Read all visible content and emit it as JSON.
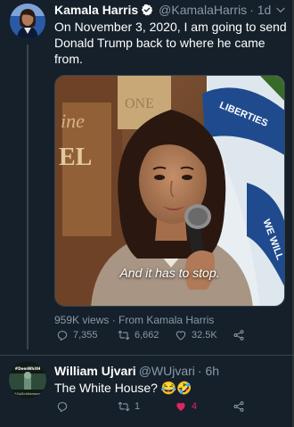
{
  "tweet1": {
    "name": "Kamala Harris",
    "handle": "@KamalaHarris",
    "time": "· 1d",
    "text": "On November 3, 2020, I am going to send Donald Trump back to where he came from.",
    "media_caption": "And it has to stop.",
    "media_sign": "LIBERTIES",
    "views": "959K views · From Kamala Harris",
    "reply_count": "7,355",
    "retweet_count": "6,662",
    "like_count": "32.5K"
  },
  "tweet2": {
    "name": "William Ujvari",
    "handle": "@WUjvari",
    "time": "· 6h",
    "text": "The White House? 😂🤣",
    "avatar_text_top": "#DemWhitH",
    "avatar_text_bottom": "#GoSchliemann",
    "reply_count": "",
    "retweet_count": "1",
    "like_count": "4"
  },
  "colors": {
    "background": "#15202b",
    "secondary_text": "#8899a6",
    "verified_blue": "#1da1f2",
    "like_red": "#e0245e",
    "divider": "#38444d"
  },
  "icons": [
    "verified-badge-icon",
    "chevron-down-icon",
    "reply-icon",
    "retweet-icon",
    "like-icon",
    "share-icon"
  ]
}
